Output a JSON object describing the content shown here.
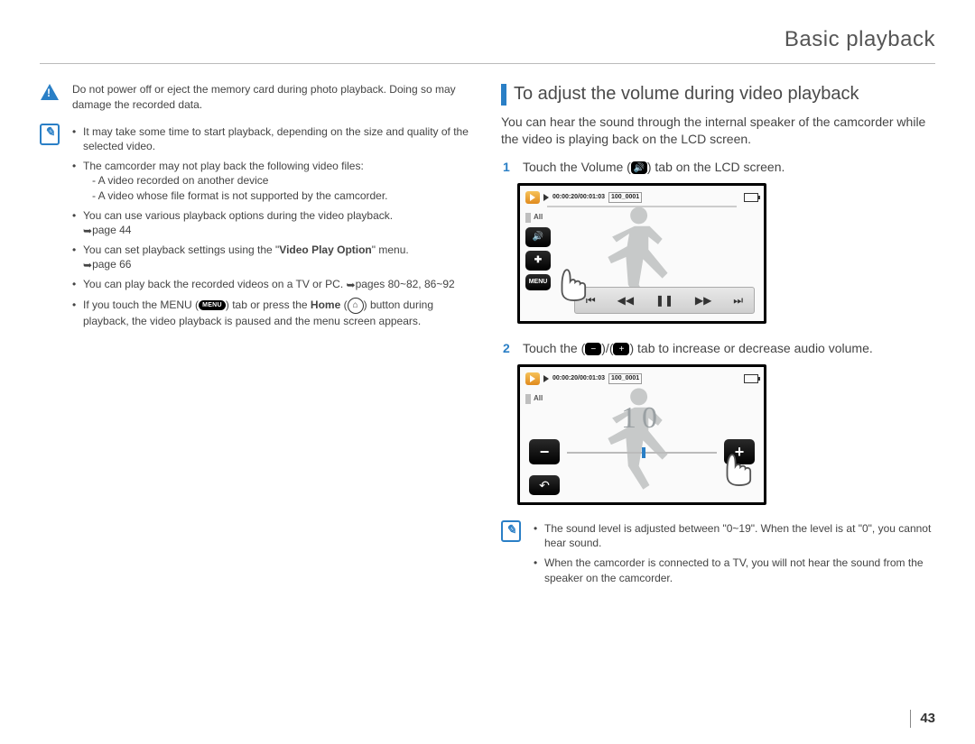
{
  "page": {
    "chapter_title": "Basic playback",
    "page_number": "43"
  },
  "left": {
    "warning_text": "Do not power off or eject the memory card during photo playback. Doing so may damage the recorded data.",
    "note_bullets": {
      "b1": "It may take some time to start playback, depending on the size and quality of the selected video.",
      "b2": "The camcorder may not play back the following video files:",
      "b2_sub1": "- A video recorded on another device",
      "b2_sub2": "- A video whose file format is not supported by the camcorder.",
      "b3_a": "You can use various playback options during the video playback. ",
      "b3_b": "page 44",
      "b4_a": "You can set playback settings using the \"",
      "b4_bold": "Video Play Option",
      "b4_b": "\" menu. ",
      "b4_c": "page 66",
      "b5_a": "You can play back the recorded videos on a TV or PC. ",
      "b5_b": "pages 80~82, 86~92",
      "b6_a": "If you touch the MENU (",
      "b6_menu": "MENU",
      "b6_b": ") tab or press the ",
      "b6_home": "Home",
      "b6_c": " (",
      "b6_d": ") button during playback, the video playback is paused and  the menu screen appears."
    }
  },
  "right": {
    "heading": "To adjust the volume during video playback",
    "intro": "You can hear the sound through the internal speaker of the camcorder while the video is playing back on the LCD screen.",
    "step1": {
      "num": "1",
      "a": "Touch the Volume (",
      "b": ") tab on the LCD screen."
    },
    "step2": {
      "num": "2",
      "a": "Touch the (",
      "b": ")/(",
      "c": ") tab to increase or decrease audio volume."
    },
    "lcd1": {
      "timecode": "00:00:20/00:01:03",
      "resolution": "100_0001",
      "tab_label": "All",
      "menu_label": "MENU"
    },
    "lcd2": {
      "timecode": "00:00:20/00:01:03",
      "resolution": "100_0001",
      "tab_label": "All",
      "volume_value": "10"
    },
    "notes": {
      "n1": "The sound level is adjusted between \"0~19\". When the level is at \"0\", you cannot hear sound.",
      "n2": "When the camcorder is connected to a TV, you will not hear the sound from the speaker on the camcorder."
    }
  }
}
